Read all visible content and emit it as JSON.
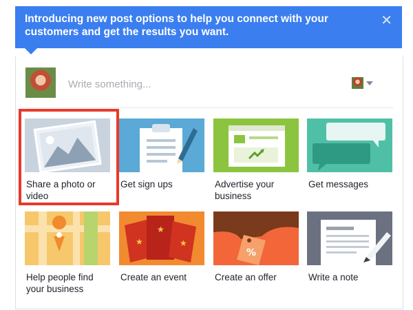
{
  "banner": {
    "text": "Introducing new post options to help you connect with your customers and get the results you want.",
    "close_icon": "close-icon"
  },
  "composer": {
    "placeholder": "Write something...",
    "avatar_icon": "profile-photo",
    "post_as_icon": "profile-photo-small"
  },
  "options": [
    {
      "label": "Share a photo or video",
      "icon": "photo-icon",
      "highlighted": true
    },
    {
      "label": "Get sign ups",
      "icon": "clipboard-signup-icon"
    },
    {
      "label": "Advertise your business",
      "icon": "browser-ad-icon"
    },
    {
      "label": "Get messages",
      "icon": "chat-bubbles-icon"
    },
    {
      "label": "Help people find your business",
      "icon": "map-pin-icon"
    },
    {
      "label": "Create an event",
      "icon": "tickets-icon"
    },
    {
      "label": "Create an offer",
      "icon": "price-tag-icon"
    },
    {
      "label": "Write a note",
      "icon": "note-pencil-icon"
    }
  ],
  "colors": {
    "banner_bg": "#3b7ef0",
    "highlight_border": "#e8392a"
  }
}
